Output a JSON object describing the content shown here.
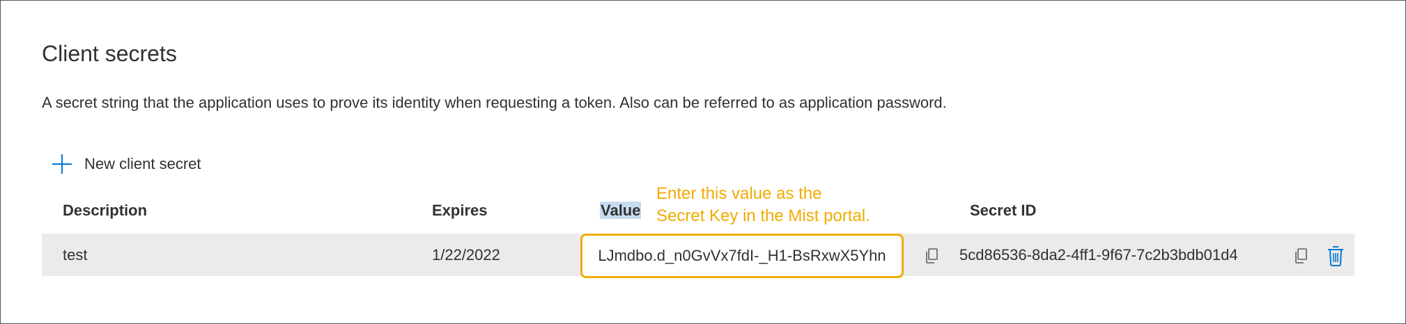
{
  "section": {
    "title": "Client secrets",
    "description": "A secret string that the application uses to prove its identity when requesting a token. Also can be referred to as application password."
  },
  "toolbar": {
    "new_secret_label": "New client secret",
    "new_secret_icon": "plus-icon"
  },
  "table": {
    "columns": {
      "description": "Description",
      "expires": "Expires",
      "value": "Value",
      "secret_id": "Secret ID"
    },
    "rows": [
      {
        "description": "test",
        "expires": "1/22/2022",
        "value": "LJmdbo.d_n0GvVx7fdI-_H1-BsRxwX5Yhn",
        "secret_id": "5cd86536-8da2-4ff1-9f67-7c2b3bdb01d4"
      }
    ]
  },
  "annotation": {
    "line1": "Enter this value as the",
    "line2": "Secret Key in the Mist portal.",
    "color": "#f0ab00"
  },
  "colors": {
    "accent": "#0078d4",
    "text": "#323130",
    "row_bg": "#ecebea",
    "value_header_highlight": "#c7dcf0"
  },
  "icons": {
    "copy_value": "copy-icon",
    "copy_id": "copy-icon",
    "delete": "trash-icon"
  }
}
